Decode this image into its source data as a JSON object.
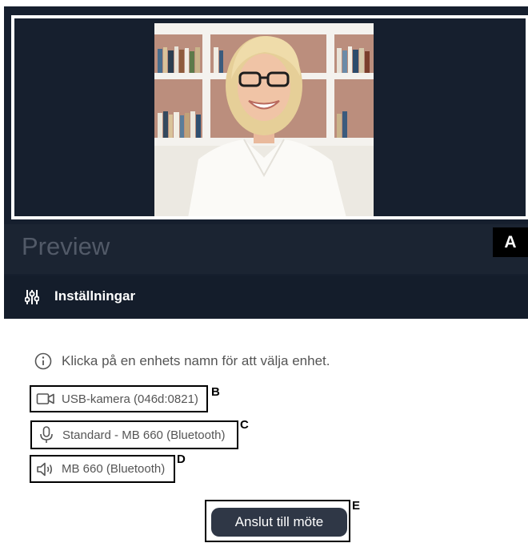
{
  "preview": {
    "title": "Preview",
    "marker": "A"
  },
  "settings": {
    "label": "Inställningar",
    "icon": "sliders-icon"
  },
  "info": {
    "text": "Klicka på en enhets namn för att välja enhet.",
    "icon": "info-icon"
  },
  "devices": {
    "camera": {
      "name": "USB-kamera (046d:0821)",
      "icon": "camera-icon",
      "marker": "B"
    },
    "microphone": {
      "name": "Standard - MB 660 (Bluetooth)",
      "icon": "microphone-icon",
      "marker": "C"
    },
    "speaker": {
      "name": "MB 660 (Bluetooth)",
      "icon": "speaker-icon",
      "marker": "D"
    }
  },
  "join": {
    "label": "Anslut till möte",
    "marker": "E"
  },
  "colors": {
    "panel": "#161f2e",
    "button": "#2f3746"
  }
}
